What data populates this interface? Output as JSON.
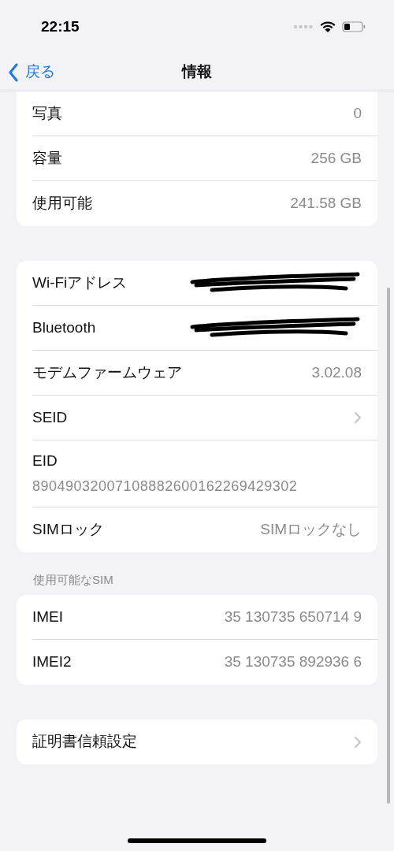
{
  "status_bar": {
    "time": "22:15"
  },
  "nav": {
    "back": "戻る",
    "title": "情報"
  },
  "groups": [
    {
      "rows": [
        {
          "kind": "value",
          "label": "写真",
          "value": "0"
        },
        {
          "kind": "value",
          "label": "容量",
          "value": "256 GB"
        },
        {
          "kind": "value",
          "label": "使用可能",
          "value": "241.58 GB"
        }
      ]
    },
    {
      "rows": [
        {
          "kind": "redacted",
          "label": "Wi-Fiアドレス"
        },
        {
          "kind": "redacted",
          "label": "Bluetooth"
        },
        {
          "kind": "value",
          "label": "モデムファームウェア",
          "value": "3.02.08"
        },
        {
          "kind": "chevron",
          "label": "SEID"
        },
        {
          "kind": "stacked",
          "label": "EID",
          "value": "89049032007108882600162269429302"
        },
        {
          "kind": "value",
          "label": "SIMロック",
          "value": "SIMロックなし"
        }
      ]
    },
    {
      "header": "使用可能なSIM",
      "rows": [
        {
          "kind": "value",
          "label": "IMEI",
          "value": "35 130735 650714 9"
        },
        {
          "kind": "value",
          "label": "IMEI2",
          "value": "35 130735 892936 6"
        }
      ]
    },
    {
      "rows": [
        {
          "kind": "chevron",
          "label": "証明書信頼設定"
        }
      ]
    }
  ]
}
